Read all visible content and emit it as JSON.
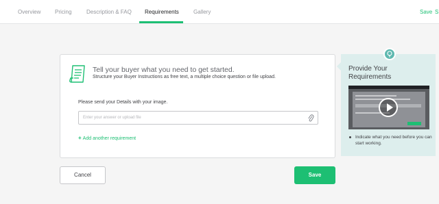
{
  "nav": {
    "tabs": [
      {
        "label": "Overview"
      },
      {
        "label": "Pricing"
      },
      {
        "label": "Description & FAQ"
      },
      {
        "label": "Requirements"
      },
      {
        "label": "Gallery"
      }
    ],
    "active_tab": "Requirements",
    "save_label": "Save",
    "partial_label": "S"
  },
  "card": {
    "icon": "document-list-icon",
    "title": "Tell your buyer what you need to get started.",
    "subtitle": "Structure your Buyer Instructions as free text, a multiple choice question or file upload.",
    "question_label": "Please send your Details with your image.",
    "answer_placeholder": "Enter your answer or upload file",
    "attach_icon": "paperclip-icon",
    "add_requirement_label": "Add another requirement"
  },
  "sidebar": {
    "icon": "lightbulb-icon",
    "title": "Provide Your Requirements",
    "video_icon": "play-icon",
    "bullets": [
      "Indicate what you need before you can start working."
    ]
  },
  "footer": {
    "cancel_label": "Cancel",
    "save_label": "Save"
  },
  "colors": {
    "accent": "#1dbf73",
    "sidebar_bg": "#ddeeed",
    "bulb": "#5fb9b0"
  }
}
